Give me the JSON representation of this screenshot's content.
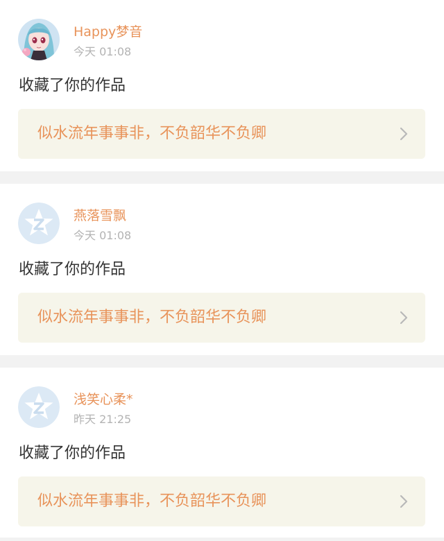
{
  "notifications": [
    {
      "username": "Happy梦音",
      "time": "今天 01:08",
      "action": "收藏了你的作品",
      "work_title": "似水流年事事非，不负韶华不负卿",
      "avatar": "anime-girl-avatar"
    },
    {
      "username": "燕落雪飘",
      "time": "今天 01:08",
      "action": "收藏了你的作品",
      "work_title": "似水流年事事非，不负韶华不负卿",
      "avatar": "default-avatar"
    },
    {
      "username": "浅笑心柔*",
      "time": "昨天 21:25",
      "action": "收藏了你的作品",
      "work_title": "似水流年事事非，不负韶华不负卿",
      "avatar": "default-avatar"
    }
  ],
  "colors": {
    "accent": "#e8935a",
    "work_bg": "#f6f5ea",
    "separator": "#f2f2f2",
    "time": "#b3b3b3",
    "text": "#333333",
    "default_avatar": "#dce9f5"
  },
  "icons": {
    "chevron": "chevron-right-icon"
  }
}
